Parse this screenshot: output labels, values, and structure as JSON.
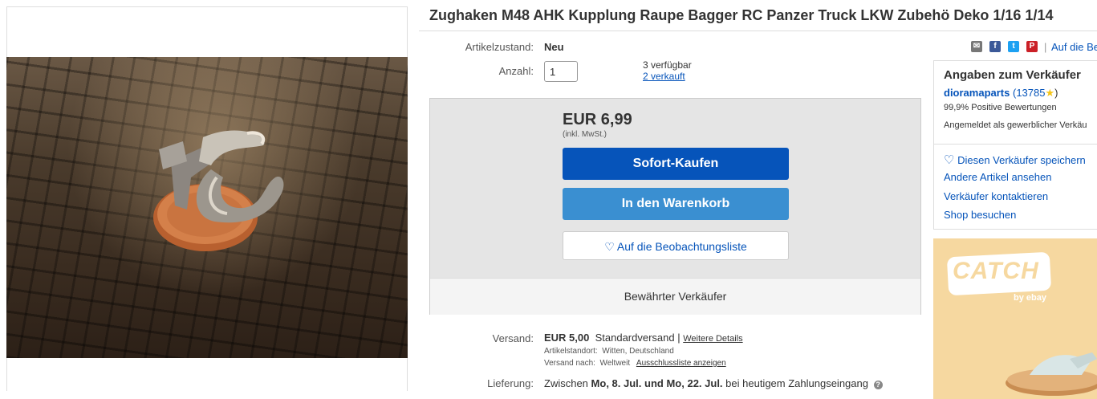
{
  "title": "Zughaken M48 AHK Kupplung Raupe Bagger RC Panzer Truck LKW Zubehö Deko 1/16 1/14",
  "condition": {
    "label": "Artikelzustand:",
    "value": "Neu"
  },
  "quantity": {
    "label": "Anzahl:",
    "value": "1",
    "available": "3 verfügbar",
    "sold": "2 verkauft"
  },
  "share": {
    "watch_link": "Auf die Be"
  },
  "price": {
    "amount": "EUR 6,99",
    "tax_note": "(inkl. MwSt.)"
  },
  "buttons": {
    "buy_now": "Sofort-Kaufen",
    "add_to_cart": "In den Warenkorb",
    "watchlist": "Auf die Beobachtungsliste"
  },
  "trusted_seller": "Bewährter Verkäufer",
  "shipping": {
    "label": "Versand:",
    "cost": "EUR 5,00",
    "method": "Standardversand |",
    "details_link": "Weitere Details",
    "location_label": "Artikelstandort:",
    "location": "Witten, Deutschland",
    "ships_to_label": "Versand nach:",
    "ships_to": "Weltweit",
    "exclusion_link": "Ausschlussliste anzeigen"
  },
  "delivery": {
    "label": "Lieferung:",
    "prefix": "Zwischen",
    "date_from": "Mo, 8. Jul.",
    "and": "und",
    "date_to": "Mo, 22. Jul.",
    "suffix": "bei heutigem Zahlungseingang"
  },
  "seller": {
    "heading": "Angaben zum Verkäufer",
    "name": "dioramaparts",
    "score": "(13785",
    "score_close": ")",
    "positive": "99,9% Positive Bewertungen",
    "registered": "Angemeldet als gewerblicher Verkäu",
    "save": "Diesen Verkäufer speichern",
    "other_items": "Andere Artikel ansehen",
    "contact": "Verkäufer kontaktieren",
    "shop": "Shop besuchen"
  },
  "ad": {
    "brand": "CATCH",
    "byline": "by ebay"
  }
}
